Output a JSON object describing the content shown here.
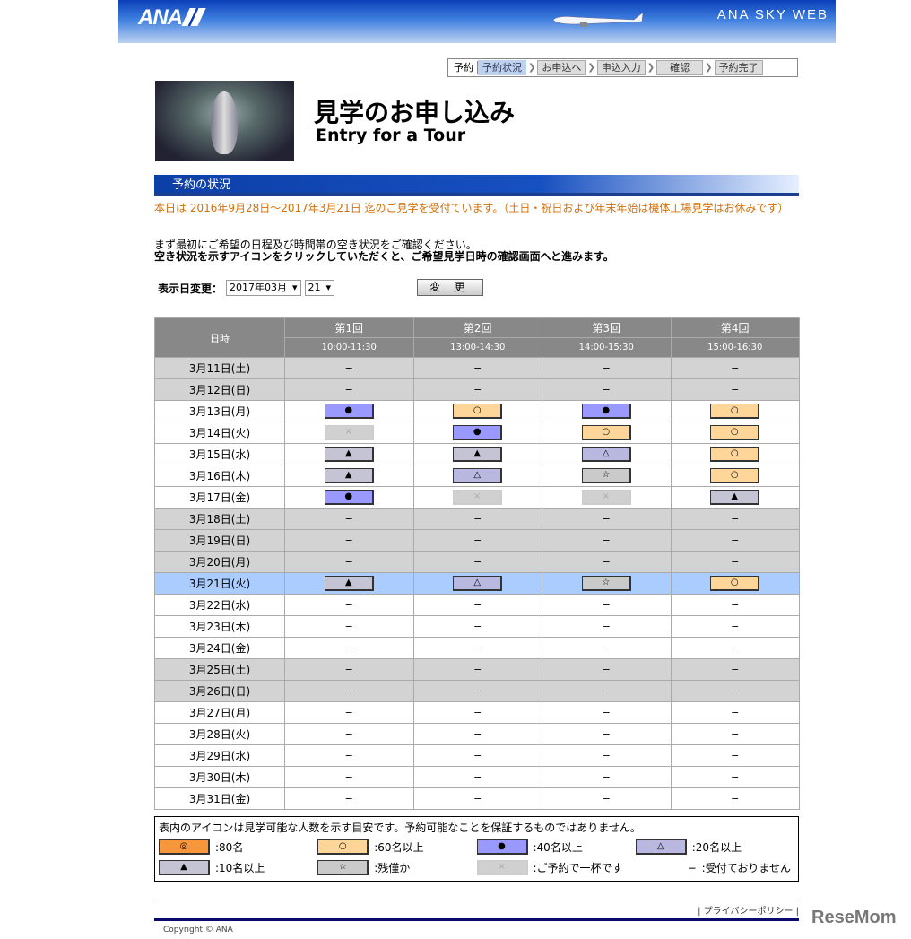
{
  "banner": {
    "logo": "ANA",
    "site": "ANA SKY WEB"
  },
  "steps": [
    "予約",
    "予約状況",
    "お申込へ",
    "申込入力",
    "確認",
    "予約完了"
  ],
  "title": {
    "ja": "見学のお申し込み",
    "en": "Entry for a Tour"
  },
  "section": "予約の状況",
  "notice": "本日は 2016年9月28日〜2017年3月21日 迄のご見学を受付ています。（土日・祝日および年末年始は機体工場見学はお休みです）",
  "instruction1": "まず最初にご希望の日程及び時間帯の空き状況をご確認ください。",
  "instruction2": "空き状況を示すアイコンをクリックしていただくと、ご希望見学日時の確認画面へと進みます。",
  "date_change": {
    "label": "表示日変更：",
    "month": "2017年03月",
    "day": "21",
    "button": "変 更"
  },
  "table": {
    "date_header": "日時",
    "sessions": [
      {
        "name": "第1回",
        "time": "10:00-11:30"
      },
      {
        "name": "第2回",
        "time": "13:00-14:30"
      },
      {
        "name": "第3回",
        "time": "14:00-15:30"
      },
      {
        "name": "第4回",
        "time": "15:00-16:30"
      }
    ],
    "rows": [
      {
        "date": "3月11日(土)",
        "type": "closed",
        "cells": [
          "-",
          "-",
          "-",
          "-"
        ]
      },
      {
        "date": "3月12日(日)",
        "type": "closed",
        "cells": [
          "-",
          "-",
          "-",
          "-"
        ]
      },
      {
        "date": "3月13日(月)",
        "type": "weekday",
        "cells": [
          "b",
          "o",
          "b",
          "o"
        ]
      },
      {
        "date": "3月14日(火)",
        "type": "weekday",
        "cells": [
          "x",
          "b",
          "o",
          "o"
        ]
      },
      {
        "date": "3月15日(水)",
        "type": "weekday",
        "cells": [
          "T",
          "T",
          "t",
          "o"
        ]
      },
      {
        "date": "3月16日(木)",
        "type": "weekday",
        "cells": [
          "T",
          "t",
          "s",
          "o"
        ]
      },
      {
        "date": "3月17日(金)",
        "type": "weekday",
        "cells": [
          "b",
          "x",
          "x",
          "T"
        ]
      },
      {
        "date": "3月18日(土)",
        "type": "closed",
        "cells": [
          "-",
          "-",
          "-",
          "-"
        ]
      },
      {
        "date": "3月19日(日)",
        "type": "closed",
        "cells": [
          "-",
          "-",
          "-",
          "-"
        ]
      },
      {
        "date": "3月20日(月)",
        "type": "closed",
        "cells": [
          "-",
          "-",
          "-",
          "-"
        ]
      },
      {
        "date": "3月21日(火)",
        "type": "selected",
        "cells": [
          "T",
          "t",
          "s",
          "o"
        ]
      },
      {
        "date": "3月22日(水)",
        "type": "weekday",
        "cells": [
          "-",
          "-",
          "-",
          "-"
        ]
      },
      {
        "date": "3月23日(木)",
        "type": "weekday",
        "cells": [
          "-",
          "-",
          "-",
          "-"
        ]
      },
      {
        "date": "3月24日(金)",
        "type": "weekday",
        "cells": [
          "-",
          "-",
          "-",
          "-"
        ]
      },
      {
        "date": "3月25日(土)",
        "type": "closed",
        "cells": [
          "-",
          "-",
          "-",
          "-"
        ]
      },
      {
        "date": "3月26日(日)",
        "type": "closed",
        "cells": [
          "-",
          "-",
          "-",
          "-"
        ]
      },
      {
        "date": "3月27日(月)",
        "type": "weekday",
        "cells": [
          "-",
          "-",
          "-",
          "-"
        ]
      },
      {
        "date": "3月28日(火)",
        "type": "weekday",
        "cells": [
          "-",
          "-",
          "-",
          "-"
        ]
      },
      {
        "date": "3月29日(水)",
        "type": "weekday",
        "cells": [
          "-",
          "-",
          "-",
          "-"
        ]
      },
      {
        "date": "3月30日(木)",
        "type": "weekday",
        "cells": [
          "-",
          "-",
          "-",
          "-"
        ]
      },
      {
        "date": "3月31日(金)",
        "type": "weekday",
        "cells": [
          "-",
          "-",
          "-",
          "-"
        ]
      }
    ]
  },
  "symbols": {
    "dbl": "◎",
    "o": "○",
    "b": "●",
    "t": "△",
    "T": "▲",
    "s": "☆",
    "x": "×",
    "-": "−"
  },
  "legend": {
    "note": "表内のアイコンは見学可能な人数を示す目安です。予約可能なことを保証するものではありません。",
    "items": [
      {
        "key": "dbl",
        "label": ":80名"
      },
      {
        "key": "o",
        "label": ":60名以上"
      },
      {
        "key": "b",
        "label": ":40名以上"
      },
      {
        "key": "t",
        "label": ":20名以上"
      },
      {
        "key": "T",
        "label": ":10名以上"
      },
      {
        "key": "s",
        "label": ":残僅か"
      },
      {
        "key": "x",
        "label": ":ご予約で一杯です"
      },
      {
        "key": "-",
        "label": ":受付ておりません"
      }
    ]
  },
  "footer": {
    "privacy": "| プライバシーポリシー |",
    "copyright": "Copyright © ANA",
    "watermark": "ReseMom"
  }
}
